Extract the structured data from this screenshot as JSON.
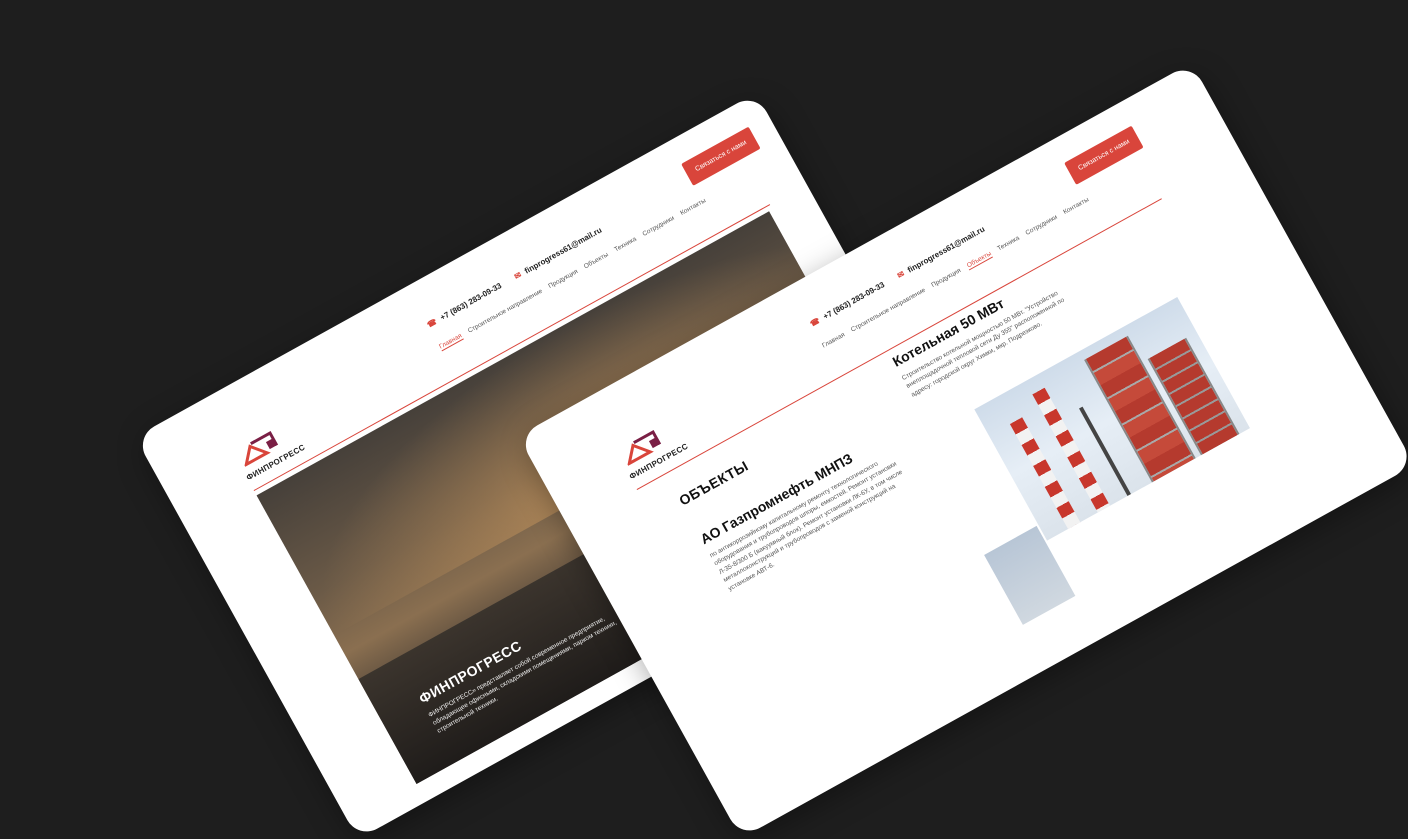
{
  "brand": {
    "logo_text": "ФИНПРОГРЕСС",
    "accent": "#d9453b"
  },
  "contacts": {
    "phone": "+7 (863) 283-09-33",
    "email": "finprogress61@mail.ru",
    "phone_icon": "phone-icon",
    "mail_icon": "mail-icon"
  },
  "cta_label": "Связаться с нами",
  "nav_left": [
    "Главная",
    "Строительное направление",
    "Продукция",
    "Объекты",
    "Техника",
    "Сотрудники",
    "Контакты"
  ],
  "nav_right": [
    "Главная",
    "Строительное направление",
    "Продукция",
    "Объекты",
    "Техника",
    "Сотрудники",
    "Контакты"
  ],
  "hero": {
    "title": "ФИНПРОГРЕСС",
    "description": "ФИНПРОГРЕСС» представляет собой современное предприятие, обладающее офисными, складскими помещениями, парком техники, строительной техники."
  },
  "objects": {
    "section_title": "ОБЪЕКТЫ",
    "item1": {
      "title": "АО Газпромнефть МНПЗ",
      "description": "по антикоррозийному капитальному ремонту технологического оборудования и трубопроводов шпоры, емкостей. Ремонт установки Л-35-8/300 Б (вакуумный блок). Ремонт установки ЛК-6У, в том числе металлоконструкций и трубопроводов с заменой конструкций на установке АВТ-6."
    },
    "item2": {
      "title": "Котельная 50 МВт",
      "description": "Строительство котельной мощностью 50 МВт. \"Устройство внеплощадочной тепловой сети Ду 355\" расположенной по адресу: городской округ Химки, мкр. Подрезково."
    }
  }
}
